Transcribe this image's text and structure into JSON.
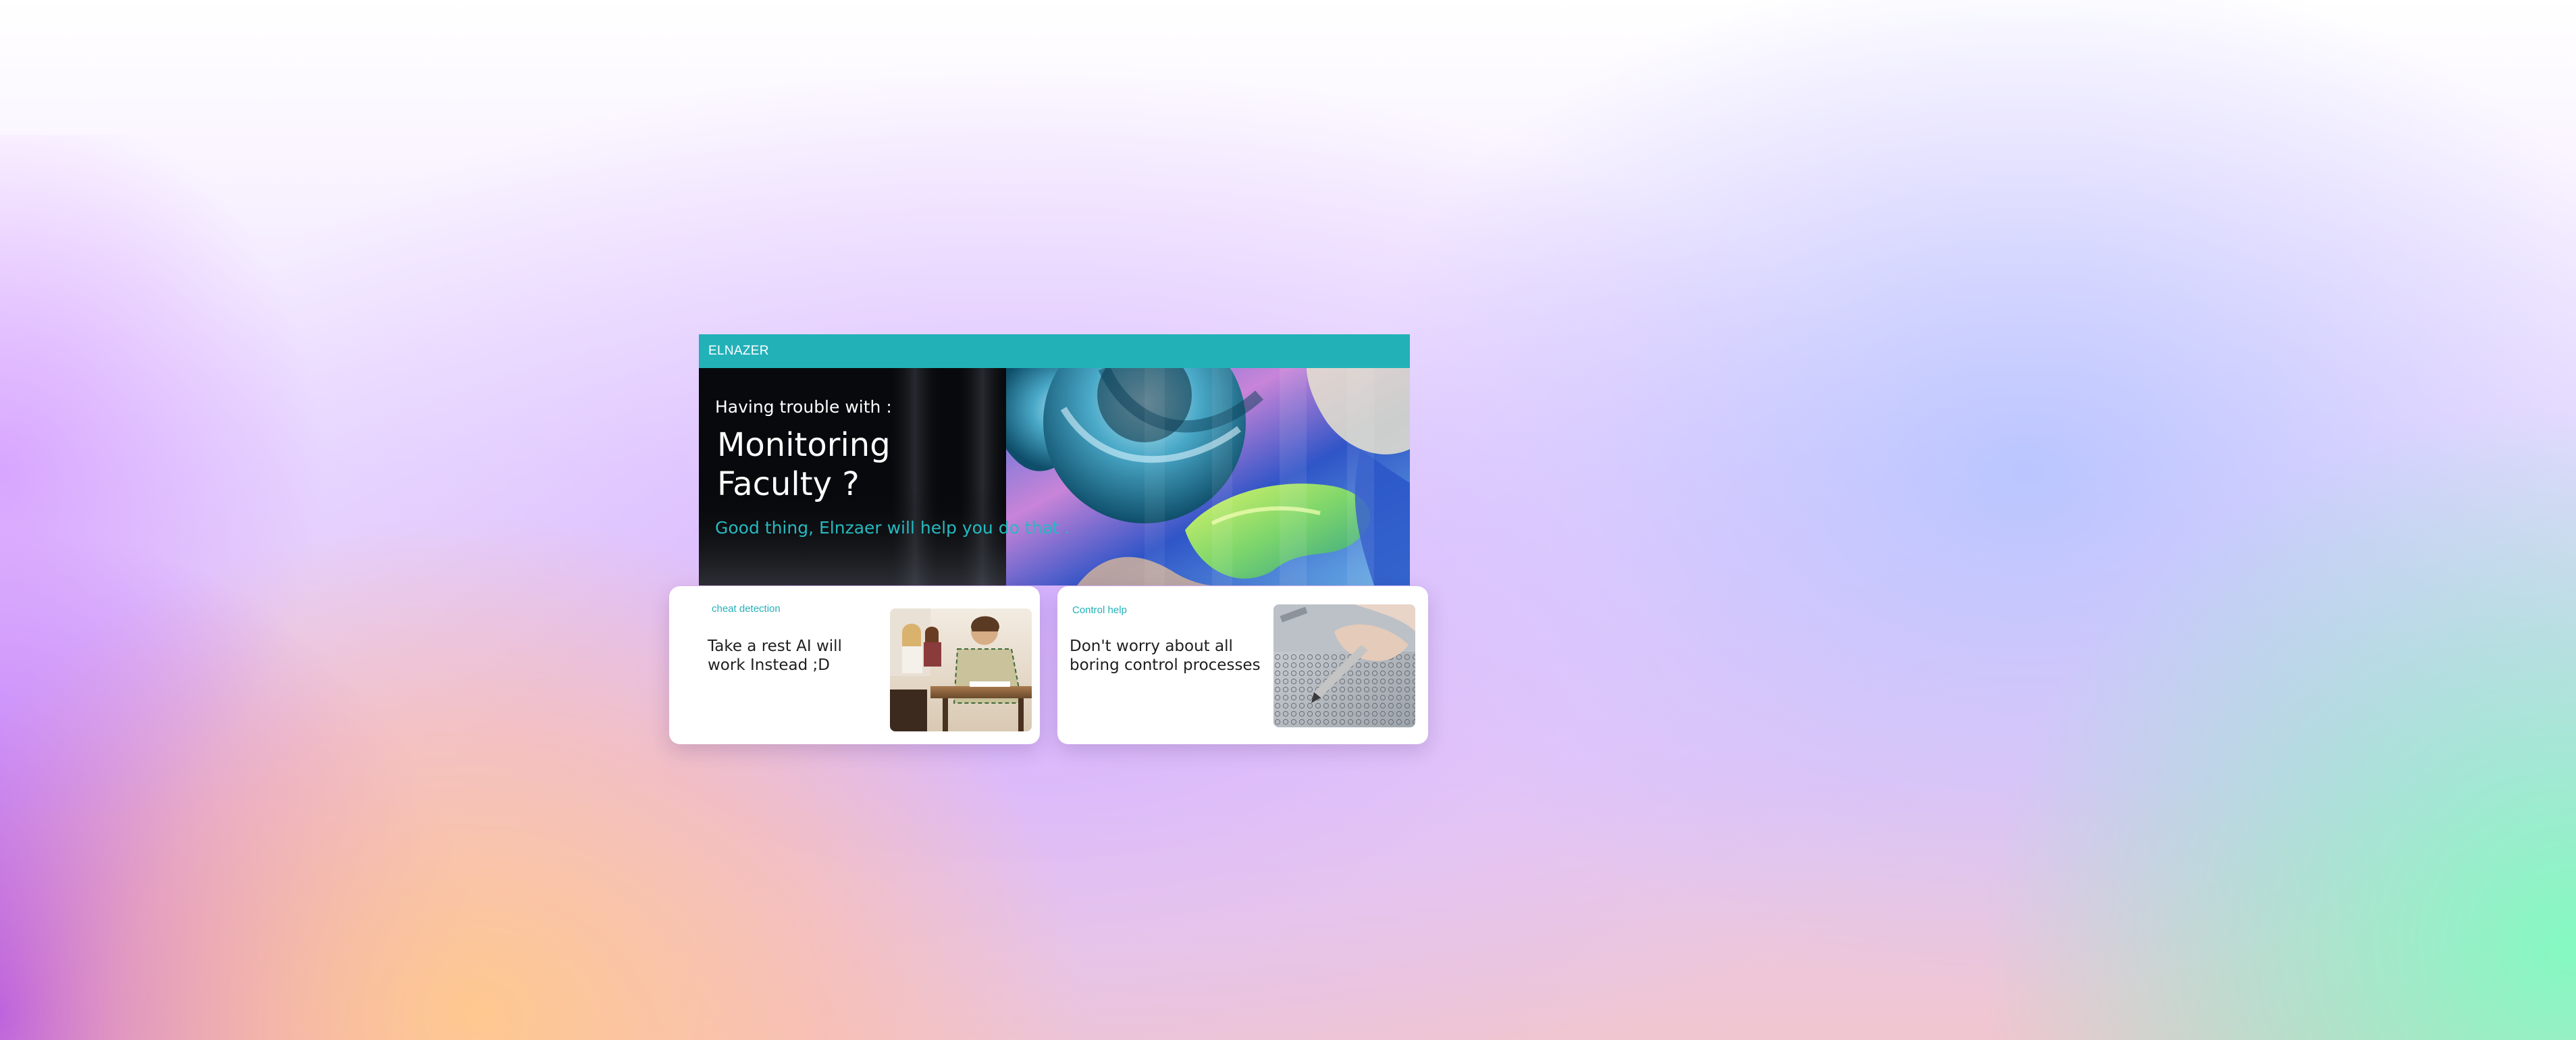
{
  "brand": "ELNAZER",
  "hero": {
    "subtitle": "Having trouble with :",
    "title": "Monitoring Faculty ?",
    "tagline": "Good thing, Elnzaer will help you do that ."
  },
  "cards": [
    {
      "tag": "cheat detection",
      "text": "Take a rest AI will work Instead ;D",
      "image": "students-taking-exam-photo"
    },
    {
      "tag": "Control help",
      "text": "Don't worry about all boring control processes",
      "image": "filling-answer-sheet-photo"
    }
  ],
  "colors": {
    "accent": "#23b1b8",
    "hero_bg": "#0a0c10",
    "card_bg": "#ffffff",
    "tagline": "#26b9c0"
  }
}
